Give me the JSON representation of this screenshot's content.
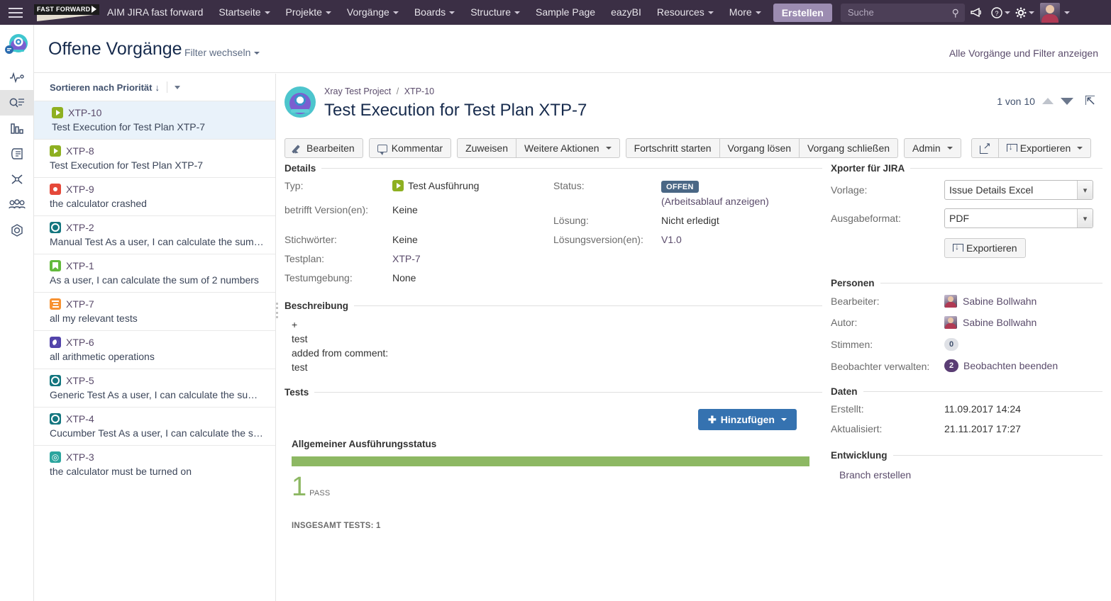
{
  "topnav": {
    "hamburger_icon": "menu-icon",
    "logo_text": "FAST FORWARD",
    "items": [
      {
        "label": "AIM JIRA fast forward",
        "caret": false
      },
      {
        "label": "Startseite",
        "caret": true
      },
      {
        "label": "Projekte",
        "caret": true
      },
      {
        "label": "Vorgänge",
        "caret": true
      },
      {
        "label": "Boards",
        "caret": true
      },
      {
        "label": "Structure",
        "caret": true
      },
      {
        "label": "Sample Page",
        "caret": false
      },
      {
        "label": "eazyBI",
        "caret": false
      },
      {
        "label": "Resources",
        "caret": true
      },
      {
        "label": "More",
        "caret": true
      }
    ],
    "create_label": "Erstellen",
    "search_placeholder": "Suche",
    "search_value": "",
    "search_icon": "search-icon",
    "icons": [
      {
        "name": "megaphone-icon",
        "glyph": "📣"
      },
      {
        "name": "help-icon",
        "glyph": "?"
      },
      {
        "name": "gear-icon",
        "glyph": "⚙"
      }
    ],
    "avatar_name": "user-avatar"
  },
  "rail": {
    "logo_icon": "xray-logo-icon",
    "items": [
      {
        "name": "activity-icon",
        "active": false
      },
      {
        "name": "search-list-icon",
        "active": true
      },
      {
        "name": "bar-chart-icon",
        "active": false
      },
      {
        "name": "report-icon",
        "active": false
      },
      {
        "name": "xray-x-icon",
        "active": false
      },
      {
        "name": "people-icon",
        "active": false
      },
      {
        "name": "gear-outline-icon",
        "active": false
      }
    ]
  },
  "page_header": {
    "title": "Offene Vorgänge",
    "filter_switch": "Filter wechseln",
    "show_all_link": "Alle Vorgänge und Filter anzeigen"
  },
  "issue_list": {
    "sort_label": "Sortieren nach Priorität",
    "sort_direction_glyph": "↓",
    "items": [
      {
        "key": "XTP-10",
        "summary": "Test Execution for Test Plan XTP-7",
        "icon": "test-execution-icon",
        "icon_shape": "play",
        "icon_color": "#8eb021",
        "selected": true
      },
      {
        "key": "XTP-8",
        "summary": "Test Execution for Test Plan XTP-7",
        "icon": "test-execution-icon",
        "icon_shape": "play",
        "icon_color": "#8eb021",
        "selected": false
      },
      {
        "key": "XTP-9",
        "summary": "the calculator crashed",
        "icon": "bug-icon",
        "icon_shape": "dot",
        "icon_color": "#e5493a",
        "selected": false
      },
      {
        "key": "XTP-2",
        "summary": "Manual Test As a user, I can calculate the sum…",
        "icon": "test-icon",
        "icon_shape": "ring",
        "icon_color": "#14767f",
        "selected": false
      },
      {
        "key": "XTP-1",
        "summary": "As a user, I can calculate the sum of 2 numbers",
        "icon": "story-icon",
        "icon_shape": "bookmark",
        "icon_color": "#63ba3c",
        "selected": false
      },
      {
        "key": "XTP-7",
        "summary": "all my relevant tests",
        "icon": "test-plan-icon",
        "icon_shape": "lines",
        "icon_color": "#f79232",
        "selected": false
      },
      {
        "key": "XTP-6",
        "summary": "all arithmetic operations",
        "icon": "test-set-icon",
        "icon_shape": "moon",
        "icon_color": "#5243aa",
        "selected": false
      },
      {
        "key": "XTP-5",
        "summary": "Generic Test As a user, I can calculate the su…",
        "icon": "test-icon",
        "icon_shape": "ring",
        "icon_color": "#14767f",
        "selected": false
      },
      {
        "key": "XTP-4",
        "summary": "Cucumber Test As a user, I can calculate the s…",
        "icon": "test-icon",
        "icon_shape": "ring",
        "icon_color": "#14767f",
        "selected": false
      },
      {
        "key": "XTP-3",
        "summary": "the calculator must be turned on",
        "icon": "precondition-icon",
        "icon_shape": "target",
        "icon_color": "#2ba59e",
        "selected": false
      }
    ]
  },
  "detail": {
    "breadcrumb_project": "Xray Test Project",
    "breadcrumb_sep": "/",
    "breadcrumb_key": "XTP-10",
    "title": "Test Execution for Test Plan XTP-7",
    "pager_text": "1 von 10",
    "toolbar": {
      "edit": "Bearbeiten",
      "comment": "Kommentar",
      "assign": "Zuweisen",
      "more_actions": "Weitere Aktionen",
      "start_progress": "Fortschritt starten",
      "resolve": "Vorgang lösen",
      "close": "Vorgang schließen",
      "admin": "Admin",
      "share_icon": "share-icon",
      "export": "Exportieren"
    },
    "details": {
      "heading": "Details",
      "type_label": "Typ:",
      "type_value": "Test Ausführung",
      "affects_label": "betrifft Version(en):",
      "affects_value": "Keine",
      "labels_label": "Stichwörter:",
      "labels_value": "Keine",
      "testplan_label": "Testplan:",
      "testplan_value": "XTP-7",
      "testenv_label": "Testumgebung:",
      "testenv_value": "None",
      "status_label": "Status:",
      "status_value": "OFFEN",
      "status_color": "#4a6785",
      "workflow_link": "(Arbeitsablauf anzeigen)",
      "resolution_label": "Lösung:",
      "resolution_value": "Nicht erledigt",
      "fixversion_label": "Lösungsversion(en):",
      "fixversion_value": "V1.0"
    },
    "description": {
      "heading": "Beschreibung",
      "lines": [
        "+",
        "test",
        "added from comment:",
        "test"
      ]
    },
    "tests": {
      "heading": "Tests",
      "add_label": "Hinzufügen",
      "exec_title": "Allgemeiner Ausführungsstatus",
      "pass_count": "1",
      "pass_label": "PASS",
      "bar_color": "#8db863",
      "total_label": "INSGESAMT TESTS: 1"
    }
  },
  "sidebar": {
    "xporter": {
      "heading": "Xporter für JIRA",
      "template_label": "Vorlage:",
      "template_value": "Issue Details Excel",
      "format_label": "Ausgabeformat:",
      "format_value": "PDF",
      "export_label": "Exportieren"
    },
    "people": {
      "heading": "Personen",
      "assignee_label": "Bearbeiter:",
      "assignee_value": "Sabine Bollwahn",
      "reporter_label": "Autor:",
      "reporter_value": "Sabine Bollwahn",
      "votes_label": "Stimmen:",
      "votes_value": "0",
      "watchers_label": "Beobachter verwalten:",
      "watchers_count": "2",
      "watchers_link": "Beobachten beenden"
    },
    "dates": {
      "heading": "Daten",
      "created_label": "Erstellt:",
      "created_value": "11.09.2017 14:24",
      "updated_label": "Aktualisiert:",
      "updated_value": "21.11.2017 17:27"
    },
    "development": {
      "heading": "Entwicklung",
      "branch_link": "Branch erstellen"
    }
  }
}
